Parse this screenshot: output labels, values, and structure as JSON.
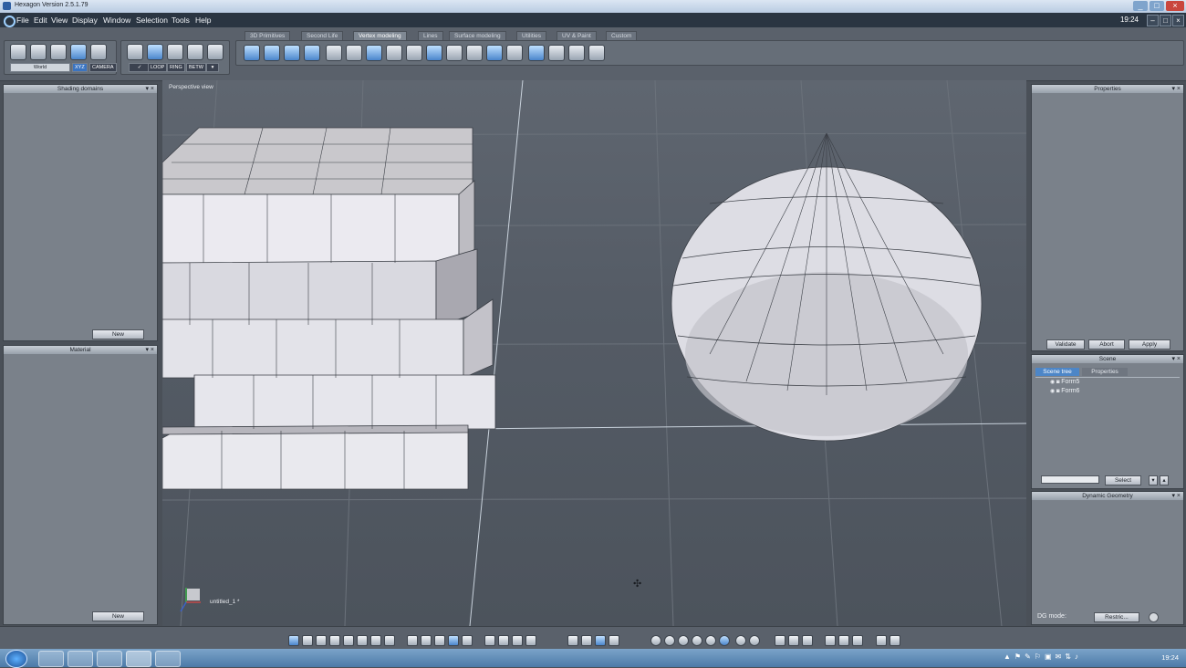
{
  "window": {
    "title": "Hexagon Version 2.5.1.79",
    "clock": "19:24"
  },
  "menu": [
    "File",
    "Edit",
    "View",
    "Display",
    "Window",
    "Selection",
    "Tools",
    "Help"
  ],
  "toolbar": {
    "coord_select": "World",
    "xyz": "XYZ",
    "camera": "CAMERA",
    "sel_buttons": [
      "LOOP",
      "RING",
      "BETW"
    ],
    "tabs": [
      {
        "label": "3D Primitives",
        "active": false
      },
      {
        "label": "Second Life",
        "active": false
      },
      {
        "label": "Vertex modeling",
        "active": true
      },
      {
        "label": "Lines",
        "active": false
      },
      {
        "label": "Surface modeling",
        "active": false
      },
      {
        "label": "Utilities",
        "active": false
      },
      {
        "label": "UV & Paint",
        "active": false
      },
      {
        "label": "Custom",
        "active": false
      }
    ]
  },
  "left_panels": {
    "shading": {
      "title": "Shading domains",
      "new_label": "New"
    },
    "material": {
      "title": "Material",
      "new_label": "New"
    }
  },
  "viewport": {
    "label": "Perspective view",
    "doc_name": "untitled_1 *"
  },
  "right_panels": {
    "properties": {
      "title": "Properties",
      "validate": "Validate",
      "abort": "Abort",
      "apply": "Apply"
    },
    "scene": {
      "title": "Scene",
      "tabs": [
        "Scene tree",
        "Properties"
      ],
      "items": [
        "Form5",
        "Form6"
      ],
      "select": "Select",
      "search_value": ""
    },
    "dynamic": {
      "title": "Dynamic Geometry",
      "dg_mode_label": "DG mode:",
      "dg_mode_value": "Restric..."
    }
  },
  "taskbar": {
    "clock": "19:24"
  },
  "colors": {
    "accent": "#4a86cc",
    "viewport_bg": "#555c66",
    "mesh": "#e7e8ee"
  }
}
